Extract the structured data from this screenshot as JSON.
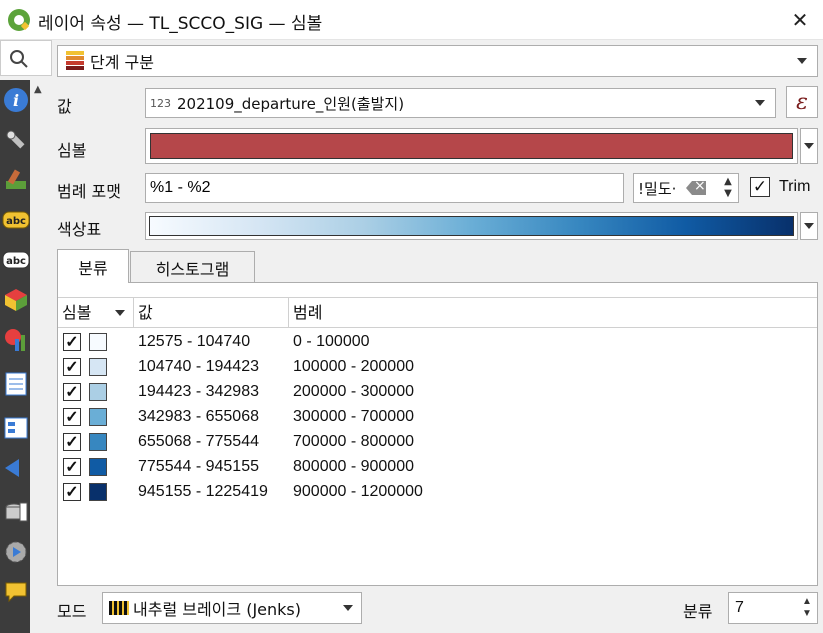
{
  "window": {
    "title": "레이어 속성 — TL_SCCO_SIG — 심볼",
    "close_glyph": "✕"
  },
  "renderer": {
    "selected": "단계 구분"
  },
  "form": {
    "value_label": "값",
    "value_type_tag": "123",
    "value_field": "202109_departure_인원(출발지)",
    "expression_glyph": "ε",
    "symbol_label": "심볼",
    "symbol_color": "#b5474a",
    "legend_format_label": "범례 포맷",
    "legend_format_value": "%1 - %2",
    "precision_text": "!밀도·",
    "trim_checked": true,
    "trim_label": "Trim",
    "color_ramp_label": "색상표"
  },
  "tabs": {
    "classify": "분류",
    "histogram": "히스토그램"
  },
  "table": {
    "headers": {
      "symbol": "심볼",
      "value": "값",
      "legend": "범례"
    },
    "rows": [
      {
        "checked": true,
        "color": "#f7fbff",
        "value": "12575 - 104740",
        "legend": "0 - 100000"
      },
      {
        "checked": true,
        "color": "#d6e6f4",
        "value": "104740 - 194423",
        "legend": "100000 - 200000"
      },
      {
        "checked": true,
        "color": "#abcfe5",
        "value": "194423 - 342983",
        "legend": "200000 - 300000"
      },
      {
        "checked": true,
        "color": "#6aaed6",
        "value": "342983 - 655068",
        "legend": "300000 - 700000"
      },
      {
        "checked": true,
        "color": "#3787c0",
        "value": "655068 - 775544",
        "legend": "700000 - 800000"
      },
      {
        "checked": true,
        "color": "#105ba4",
        "value": "775544 - 945155",
        "legend": "800000 - 900000"
      },
      {
        "checked": true,
        "color": "#08306b",
        "value": "945155 - 1225419",
        "legend": "900000 - 1200000"
      }
    ]
  },
  "footer": {
    "mode_label": "모드",
    "mode_value": "내추럴 브레이크 (Jenks)",
    "classes_label": "분류",
    "classes_value": "7"
  },
  "left_panel": {
    "icons": [
      "information-icon",
      "source-icon",
      "symbology-icon",
      "labels-icon",
      "labels-mask-icon",
      "3d-view-icon",
      "diagrams-icon",
      "fields-icon",
      "attributes-form-icon",
      "joins-icon",
      "auxiliary-storage-icon",
      "actions-icon",
      "display-icon"
    ]
  }
}
